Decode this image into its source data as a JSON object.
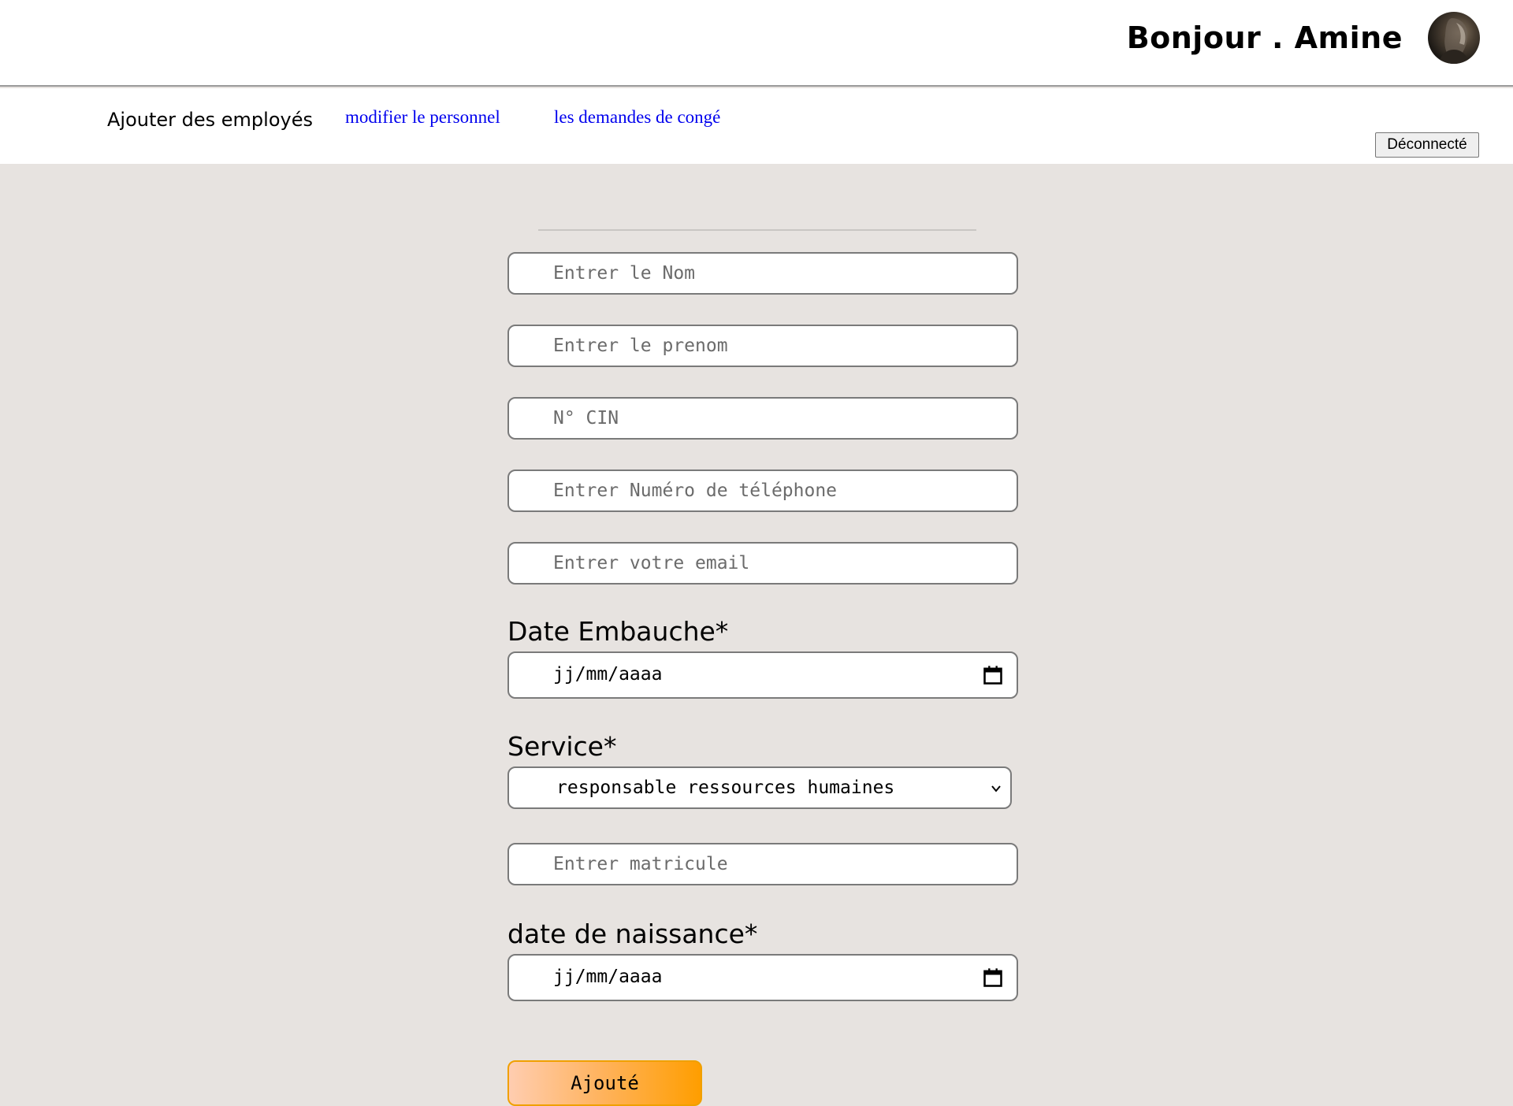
{
  "header": {
    "greeting": "Bonjour . Amine",
    "avatar_icon": "user-photo-avatar"
  },
  "nav": {
    "active_label": "Ajouter des employés",
    "links": [
      {
        "label": "modifier le personnel"
      },
      {
        "label": "les demandes de congé"
      }
    ],
    "logout_label": "Déconnecté",
    "link_color": "#0000ee"
  },
  "form": {
    "nom_placeholder": "Entrer le Nom",
    "prenom_placeholder": "Entrer le prenom",
    "cin_placeholder": "N° CIN",
    "telephone_placeholder": "Entrer Numéro de téléphone",
    "email_placeholder": "Entrer votre email",
    "date_embauche_label": "Date Embauche*",
    "date_embauche_value": "jj/mm/aaaa",
    "service_label": "Service*",
    "service_selected": "responsable ressources humaines",
    "matricule_placeholder": "Entrer matricule",
    "date_naissance_label": "date de naissance*",
    "date_naissance_value": "jj/mm/aaaa",
    "submit_label": "Ajouté",
    "calendar_icon": "calendar-icon",
    "select_icon": "chevron-down-icon"
  },
  "colors": {
    "page_background": "#e7e3e0",
    "submit_gradient_start": "#ffcdb0",
    "submit_gradient_end": "#ff9e00"
  }
}
